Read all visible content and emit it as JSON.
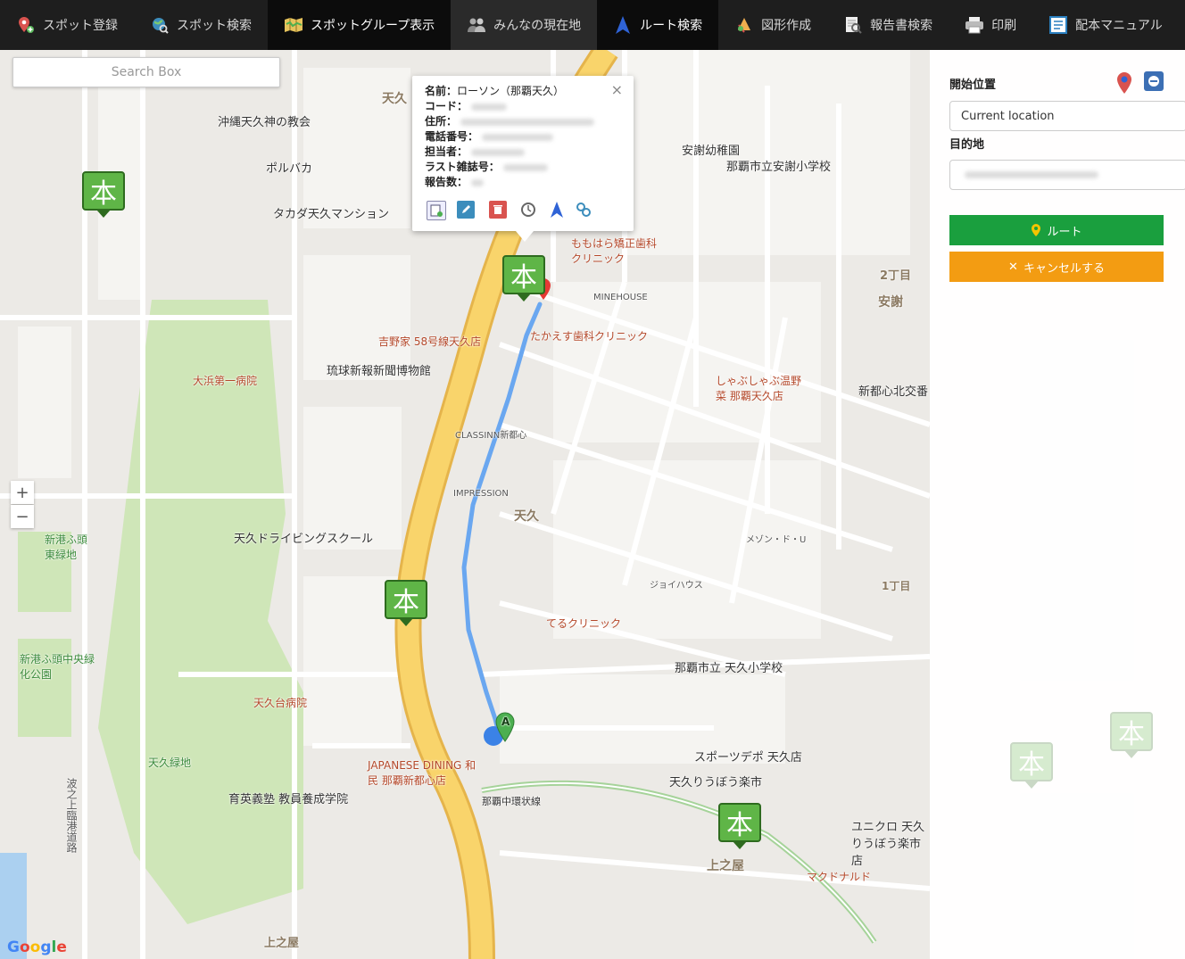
{
  "nav": {
    "items": [
      {
        "label": "スポット登録",
        "icon": "pin-plus-icon"
      },
      {
        "label": "スポット検索",
        "icon": "globe-search-icon"
      },
      {
        "label": "スポットグループ表示",
        "icon": "map-icon",
        "active": true
      },
      {
        "label": "みんなの現在地",
        "icon": "people-icon"
      },
      {
        "label": "ルート検索",
        "icon": "navigation-arrow-icon",
        "active": true
      },
      {
        "label": "図形作成",
        "icon": "shapes-icon"
      },
      {
        "label": "報告書検索",
        "icon": "report-search-icon"
      },
      {
        "label": "印刷",
        "icon": "printer-icon"
      },
      {
        "label": "配本マニュアル",
        "icon": "manual-icon"
      }
    ]
  },
  "map": {
    "search_placeholder": "Search Box",
    "zoom_in": "+",
    "zoom_out": "−",
    "google": "Google",
    "labels": {
      "l1": "沖縄天久神の教会",
      "l2": "ポルバカ",
      "l3": "タカダ天久マンション",
      "l4": "大浜第一病院",
      "l5": "琉球新報新聞博物館",
      "l6": "天久ドライビングスクール",
      "l7": "新港ふ頭東緑地",
      "l8": "天久台病院",
      "l9": "天久緑地",
      "l10": "育英義塾 教員養成学院",
      "l11": "新港ふ頭中央緑化公園",
      "l12": "吉野家 58号線天久店",
      "l13": "たかえす歯科クリニック",
      "l14": "ももはら矯正歯科クリニック",
      "l15": "安謝幼稚園",
      "l16": "那覇市立安謝小学校",
      "l17": "しゃぶしゃぶ温野菜 那覇天久店",
      "l18": "新都心北交番",
      "l19": "天久",
      "l20": "てるクリニック",
      "l21": "那覇市立 天久小学校",
      "l22": "スポーツデポ 天久店",
      "l23": "天久りうぼう楽市",
      "l24": "JAPANESE DINING 和民 那覇新都心店",
      "l25": "那覇中環状線",
      "l26": "ユニクロ 天久りうぼう楽市店",
      "l27": "マクドナルド",
      "l28": "上之屋",
      "l29": "1丁目",
      "l30": "2丁目",
      "l31": "安謝",
      "l32": "ジョイハウス",
      "l33": "波之上臨港道路",
      "l34": "天久",
      "l35": "IMPRESSION",
      "l36": "CLASSINN新都心",
      "l37": "MINEHOUSE",
      "l38": "メゾン・ド・U",
      "l39": "1丁目",
      "l40": "上之屋"
    },
    "popup": {
      "name_label": "名前：",
      "name_value": "ローソン（那覇天久）",
      "code_label": "コード：",
      "address_label": "住所：",
      "phone_label": "電話番号：",
      "person_label": "担当者：",
      "last_label": "ラスト雑誌号：",
      "report_label": "報告数：",
      "close": "×"
    },
    "route_marker": "A",
    "hon_char": "本"
  },
  "panel": {
    "start_label": "開始位置",
    "start_value": "Current location",
    "dest_label": "目的地",
    "route_button": "ルート",
    "cancel_button": "キャンセルする",
    "route_color": "#1a9f3e",
    "cancel_color": "#f39c12"
  }
}
